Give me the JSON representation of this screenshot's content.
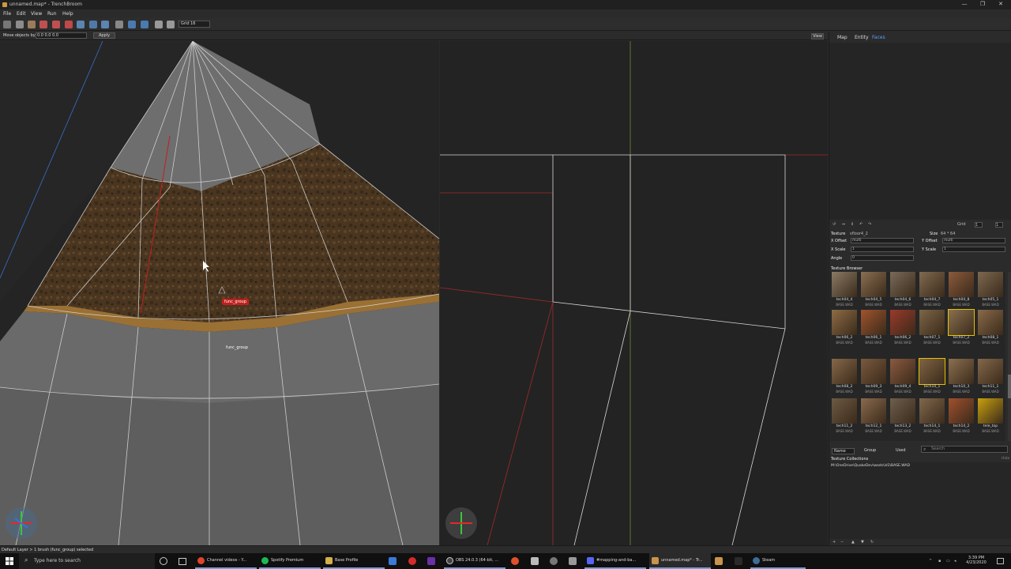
{
  "window": {
    "title": "unnamed.map* - TrenchBroom",
    "controls": [
      "—",
      "❐",
      "✕"
    ]
  },
  "menu": [
    "File",
    "Edit",
    "View",
    "Run",
    "Help"
  ],
  "toolbar": {
    "grid_label": "Grid 16"
  },
  "move_bar": {
    "label": "Move objects by",
    "value": "0.0 0.0 0.0",
    "apply_label": "Apply"
  },
  "view_button": "View",
  "viewport3d": {
    "tag_red": "func_group",
    "tag_white": "func_group"
  },
  "right_panel": {
    "tabs": [
      "Map",
      "Entity",
      "Faces"
    ],
    "active_tab": "Faces",
    "grid_label": "Grid",
    "grid_values": [
      "1",
      "1"
    ],
    "texture_label": "Texture",
    "texture_value": "sfloor4_2",
    "size_label": "Size",
    "size_value": "64 * 64",
    "x_offset_label": "X Offset",
    "x_offset_value": "multi",
    "y_offset_label": "Y Offset",
    "y_offset_value": "multi",
    "x_scale_label": "X Scale",
    "x_scale_value": "1",
    "y_scale_label": "Y Scale",
    "y_scale_value": "1",
    "angle_label": "Angle",
    "angle_value": "0",
    "texture_browser_title": "Texture Browser",
    "textures": [
      {
        "name": "tech04_4",
        "wad": "BASE.WAD",
        "color": "#8a7b66"
      },
      {
        "name": "tech04_5",
        "wad": "BASE.WAD",
        "color": "#8a6e52"
      },
      {
        "name": "tech04_6",
        "wad": "BASE.WAD",
        "color": "#7a6a58"
      },
      {
        "name": "tech04_7",
        "wad": "BASE.WAD",
        "color": "#806a50"
      },
      {
        "name": "tech04_8",
        "wad": "BASE.WAD",
        "color": "#8b5a3c"
      },
      {
        "name": "tech05_1",
        "wad": "BASE.WAD",
        "color": "#7d6850"
      },
      {
        "name": "tech06_2",
        "wad": "BASE.WAD",
        "color": "#8e6c46"
      },
      {
        "name": "tech06_1",
        "wad": "BASE.WAD",
        "color": "#a0542e"
      },
      {
        "name": "tech06_2",
        "wad": "BASE.WAD",
        "color": "#9a3a2a"
      },
      {
        "name": "tech07_1",
        "wad": "BASE.WAD",
        "color": "#7d6648"
      },
      {
        "name": "tech07_2",
        "wad": "BASE.WAD",
        "color": "#8a7050"
      },
      {
        "name": "tech08_1",
        "wad": "BASE.WAD",
        "color": "#8a6a4a"
      },
      {
        "name": "tech08_2",
        "wad": "BASE.WAD",
        "color": "#86684a"
      },
      {
        "name": "tech09_3",
        "wad": "BASE.WAD",
        "color": "#7a5a3e"
      },
      {
        "name": "tech09_4",
        "wad": "BASE.WAD",
        "color": "#8a5a40"
      },
      {
        "name": "tech10_1",
        "wad": "BASE.WAD",
        "color": "#7e6444"
      },
      {
        "name": "tech10_3",
        "wad": "BASE.WAD",
        "color": "#8c7050"
      },
      {
        "name": "tech11_1",
        "wad": "BASE.WAD",
        "color": "#84684a"
      },
      {
        "name": "tech11_2",
        "wad": "BASE.WAD",
        "color": "#6e5a44"
      },
      {
        "name": "tech12_1",
        "wad": "BASE.WAD",
        "color": "#8a6a4e"
      },
      {
        "name": "tech13_2",
        "wad": "BASE.WAD",
        "color": "#6e5e4c"
      },
      {
        "name": "tech14_1",
        "wad": "BASE.WAD",
        "color": "#80684c"
      },
      {
        "name": "tech14_2",
        "wad": "BASE.WAD",
        "color": "#a0502e"
      },
      {
        "name": "tele_top",
        "wad": "BASE.WAD",
        "color": "#c8a010"
      }
    ],
    "sort_name": "Name",
    "group_label": "Group",
    "used_label": "Used",
    "search_placeholder": "Search",
    "texture_collections_title": "Texture Collections",
    "collection_path": "M:\\OneDrive\\QuakeDev\\wads\\id1\\BASE.WAD",
    "hide_label": "Hide"
  },
  "status_bar": {
    "text": "Default Layer > 1 brush (func_group) selected"
  },
  "taskbar": {
    "search_placeholder": "Type here to search",
    "apps": [
      {
        "label": "Channel videos - Y...",
        "color": "#e0442c"
      },
      {
        "label": "Spotify Premium",
        "color": "#1db954"
      },
      {
        "label": "Base Profile",
        "color": "#d4b04a"
      },
      {
        "label": "OBS 24.0.3 (64-bit, ...",
        "color": "#444444"
      },
      {
        "label": "#mapping-and-ba...",
        "color": "#5865f2"
      },
      {
        "label": "unnamed.map* - Tr...",
        "color": "#c9944a"
      },
      {
        "label": "Steam",
        "color": "#1b2838"
      }
    ],
    "time": "3:39 PM",
    "date": "4/23/2020"
  }
}
